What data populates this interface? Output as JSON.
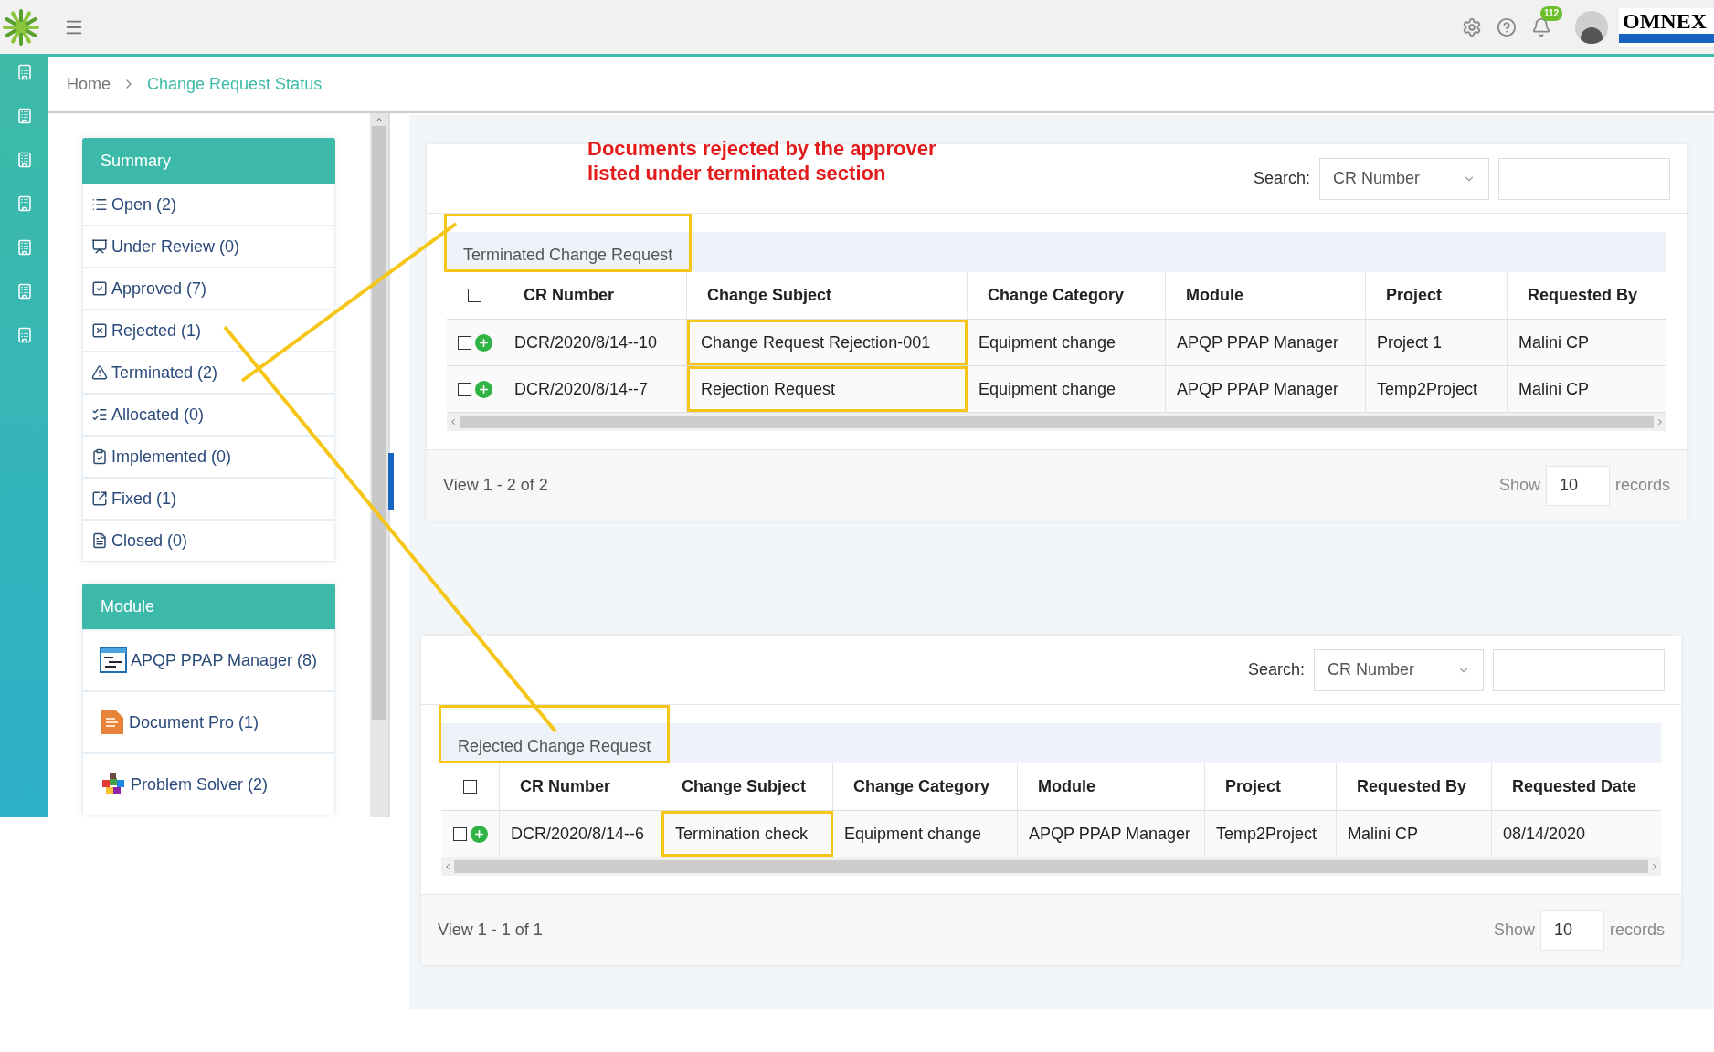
{
  "topbar": {
    "notification_count": "112",
    "brand": "OMNEX"
  },
  "breadcrumb": [
    {
      "label": "Home",
      "selected": false
    },
    {
      "label": "Change Request Status",
      "selected": true
    }
  ],
  "summary": {
    "title": "Summary",
    "items": [
      {
        "label": "Open (2)"
      },
      {
        "label": "Under Review (0)"
      },
      {
        "label": "Approved (7)"
      },
      {
        "label": "Rejected (1)"
      },
      {
        "label": "Terminated (2)"
      },
      {
        "label": "Allocated (0)"
      },
      {
        "label": "Implemented (0)"
      },
      {
        "label": "Fixed (1)"
      },
      {
        "label": "Closed (0)"
      }
    ]
  },
  "module": {
    "title": "Module",
    "items": [
      {
        "label": "APQP PPAP Manager (8)"
      },
      {
        "label": "Document Pro (1)"
      },
      {
        "label": "Problem Solver (2)"
      }
    ]
  },
  "annotation": {
    "note": [
      "Documents rejected by the approver",
      "listed under terminated section"
    ]
  },
  "sections": [
    {
      "search_label": "Search:",
      "search_by": "CR Number",
      "title": "Terminated Change Request",
      "title_highlighted": true,
      "select_all_checked": false,
      "columns": [
        {
          "label": "CR Number",
          "highlighted": false
        },
        {
          "label": "Change Subject",
          "highlighted": true
        },
        {
          "label": "Change Category",
          "highlighted": false
        },
        {
          "label": "Module",
          "highlighted": false
        },
        {
          "label": "Project",
          "highlighted": false
        },
        {
          "label": "Requested By",
          "highlighted": false
        }
      ],
      "rows": [
        {
          "checked": false,
          "cells": [
            "DCR/2020/8/14--10",
            "Change Request Rejection-001",
            "Equipment change",
            "APQP PPAP Manager",
            "Project 1",
            "Malini CP"
          ]
        },
        {
          "checked": false,
          "cells": [
            "DCR/2020/8/14--7",
            "Rejection Request",
            "Equipment change",
            "APQP PPAP Manager",
            "Temp2Project",
            "Malini CP"
          ]
        }
      ],
      "view": "View 1 - 2 of 2",
      "show_label": "Show",
      "page_size": "10",
      "records_label": "records"
    },
    {
      "search_label": "Search:",
      "search_by": "CR Number",
      "title": "Rejected Change Request",
      "title_highlighted": true,
      "select_all_checked": false,
      "columns": [
        {
          "label": "CR Number",
          "highlighted": false
        },
        {
          "label": "Change Subject",
          "highlighted": true
        },
        {
          "label": "Change Category",
          "highlighted": false
        },
        {
          "label": "Module",
          "highlighted": false
        },
        {
          "label": "Project",
          "highlighted": false
        },
        {
          "label": "Requested By",
          "highlighted": false
        },
        {
          "label": "Requested Date",
          "highlighted": false
        }
      ],
      "rows": [
        {
          "checked": false,
          "cells": [
            "DCR/2020/8/14--6",
            "Termination check",
            "Equipment change",
            "APQP PPAP Manager",
            "Temp2Project",
            "Malini CP",
            "08/14/2020"
          ]
        }
      ],
      "view": "View 1 - 1 of 1",
      "show_label": "Show",
      "page_size": "10",
      "records_label": "records"
    }
  ]
}
